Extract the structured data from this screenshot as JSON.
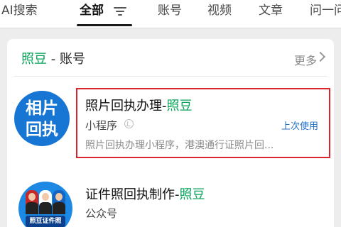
{
  "tabs": [
    "AI搜索",
    "全部",
    "账号",
    "视频",
    "文章",
    "问一问"
  ],
  "active_tab": "全部",
  "section": {
    "title_keyword": "照豆",
    "title_suffix": " - 账号",
    "more_label": "更多"
  },
  "results": [
    {
      "avatar_lines": [
        "相片",
        "回执"
      ],
      "title_prefix": "照片回执办理-",
      "title_keyword": "照豆",
      "type_label": "小程序",
      "type_icon": "verified-icon",
      "last_used_label": "上次使用",
      "description": "照片回执办理小程序，港澳通行证照片回..."
    },
    {
      "avatar_badge": "照豆证件照",
      "title_prefix": "证件照回执制作-",
      "title_keyword": "照豆",
      "type_label": "公众号"
    }
  ],
  "colors": {
    "accent": "#07a35a",
    "link": "#1f6fc5",
    "highlight_border": "#d9262e",
    "avatar_blue": "#1776d4"
  }
}
